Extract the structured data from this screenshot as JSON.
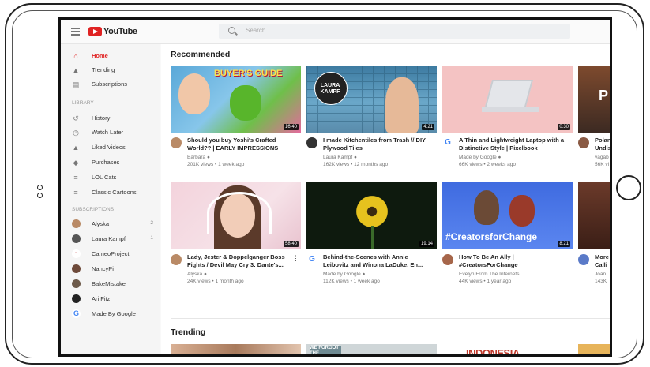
{
  "app": {
    "logo_text": "YouTube",
    "logo_color": "#e02323"
  },
  "search": {
    "placeholder": "Search"
  },
  "sidebar": {
    "main": [
      {
        "label": "Home",
        "icon": "home-icon",
        "active": true
      },
      {
        "label": "Trending",
        "icon": "flame-icon"
      },
      {
        "label": "Subscriptions",
        "icon": "subscriptions-icon"
      }
    ],
    "library_heading": "LIBRARY",
    "library": [
      {
        "label": "History",
        "icon": "history-icon"
      },
      {
        "label": "Watch Later",
        "icon": "clock-icon"
      },
      {
        "label": "Liked Videos",
        "icon": "thumbs-up-icon"
      },
      {
        "label": "Purchases",
        "icon": "tag-icon"
      },
      {
        "label": "LOL Cats",
        "icon": "playlist-icon"
      },
      {
        "label": "Classic Cartoons!",
        "icon": "playlist-icon"
      }
    ],
    "subscriptions_heading": "SUBSCRIPTIONS",
    "subscriptions": [
      {
        "label": "Alyska",
        "count": "2",
        "color": "#b98a66"
      },
      {
        "label": "Laura Kampf",
        "count": "1",
        "color": "#555555"
      },
      {
        "label": "CameoProject",
        "count": "",
        "color": "#c44a4a"
      },
      {
        "label": "NancyPi",
        "count": "",
        "color": "#6e4a3a"
      },
      {
        "label": "BakeMistake",
        "count": "",
        "color": "#6d5a4a"
      },
      {
        "label": "Ari Fitz",
        "count": "",
        "color": "#222222"
      },
      {
        "label": "Made By Google",
        "count": "",
        "color": "#4285f4"
      }
    ]
  },
  "recommended": {
    "title": "Recommended",
    "row1": [
      {
        "title": "Should you buy Yoshi's Crafted World?? | EARLY IMPRESSIONS",
        "channel": "Barbara",
        "meta": "201K views • 1 week ago",
        "duration": "16:40",
        "thumb_text": "BUYER'S GUIDE"
      },
      {
        "title": "I made Kitchentiles from Trash // DIY Plywood Tiles",
        "channel": "Laura Kampf",
        "meta": "162K views • 12 months ago",
        "duration": "4:21",
        "thumb_text": "LAURA KAMPF"
      },
      {
        "title": "A Thin and Lightweight Laptop with a Distinctive Style | Pixelbook",
        "channel": "Made by Google",
        "meta": "66K views • 2 weeks ago",
        "duration": "0:30",
        "thumb_text": ""
      },
      {
        "title": "Polan Undis",
        "channel": "vagab",
        "meta": "56K vi",
        "duration": "",
        "thumb_text": "P"
      }
    ],
    "row2": [
      {
        "title": "Lady, Jester & Doppelganger Boss Fights / Devil May Cry 3: Dante's...",
        "channel": "Alyska",
        "meta": "24K views • 1 month ago",
        "duration": "58:40",
        "thumb_text": ""
      },
      {
        "title": "Behind-the-Scenes with Annie Leibovitz and Winona LaDuke, En...",
        "channel": "Made by Google",
        "meta": "112K views • 1 week ago",
        "duration": "19:14",
        "thumb_text": ""
      },
      {
        "title": "How To Be An Ally | #CreatorsForChange",
        "channel": "Evelyn From The Internets",
        "meta": "44K views • 1 year ago",
        "duration": "8:21",
        "thumb_text": "#CreatorsforChange"
      },
      {
        "title": "More Calli",
        "channel": "Joan",
        "meta": "143K",
        "duration": "",
        "thumb_text": ""
      }
    ]
  },
  "trending": {
    "title": "Trending",
    "thumbs": [
      {
        "thumb_text": ""
      },
      {
        "thumb_text": "WE FORGOT THE"
      },
      {
        "thumb_text": "INDONESIA"
      },
      {
        "thumb_text": ""
      }
    ]
  }
}
